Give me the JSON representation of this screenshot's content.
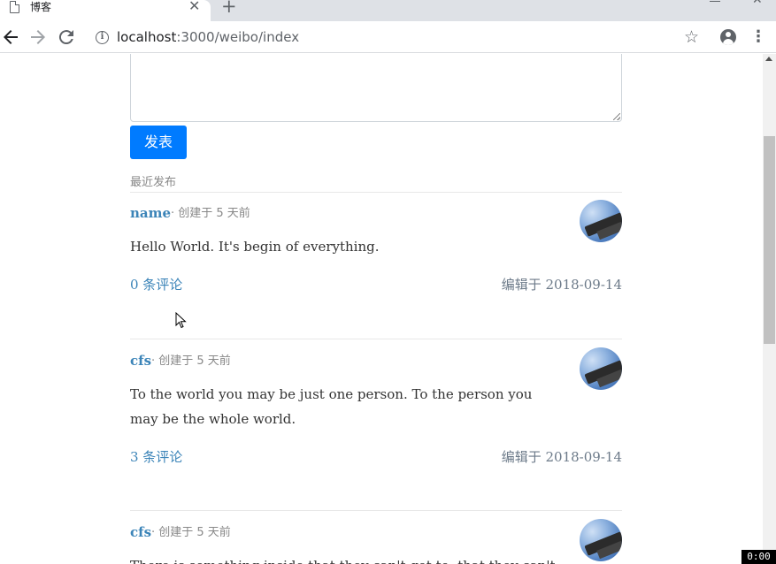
{
  "browser": {
    "tab_title": "博客",
    "tab_close": "✕",
    "new_tab": "+",
    "url_host": "localhost",
    "url_rest": ":3000/weibo/index"
  },
  "compose": {
    "publish_label": "发表",
    "section_label": "最近发布"
  },
  "posts": [
    {
      "author": "name",
      "created": "· 创建于 5 天前",
      "content": "Hello World. It's begin of everything.",
      "comments": "0 条评论",
      "edited": "编辑于 2018-09-14"
    },
    {
      "author": "cfs",
      "created": "· 创建于 5 天前",
      "content": "To the world you may be just one person. To the person you may be the whole world.",
      "comments": "3 条评论",
      "edited": "编辑于 2018-09-14"
    },
    {
      "author": "cfs",
      "created": "· 创建于 5 天前",
      "content": "There is something inside that they can't get to, that they can't"
    }
  ],
  "overlay": {
    "timer": "0:00"
  },
  "icons": {
    "back": "arrow-left-icon",
    "forward": "arrow-right-icon",
    "reload": "reload-icon",
    "info": "info-icon",
    "star": "star-icon",
    "account": "account-icon",
    "menu": "kebab-menu-icon"
  }
}
